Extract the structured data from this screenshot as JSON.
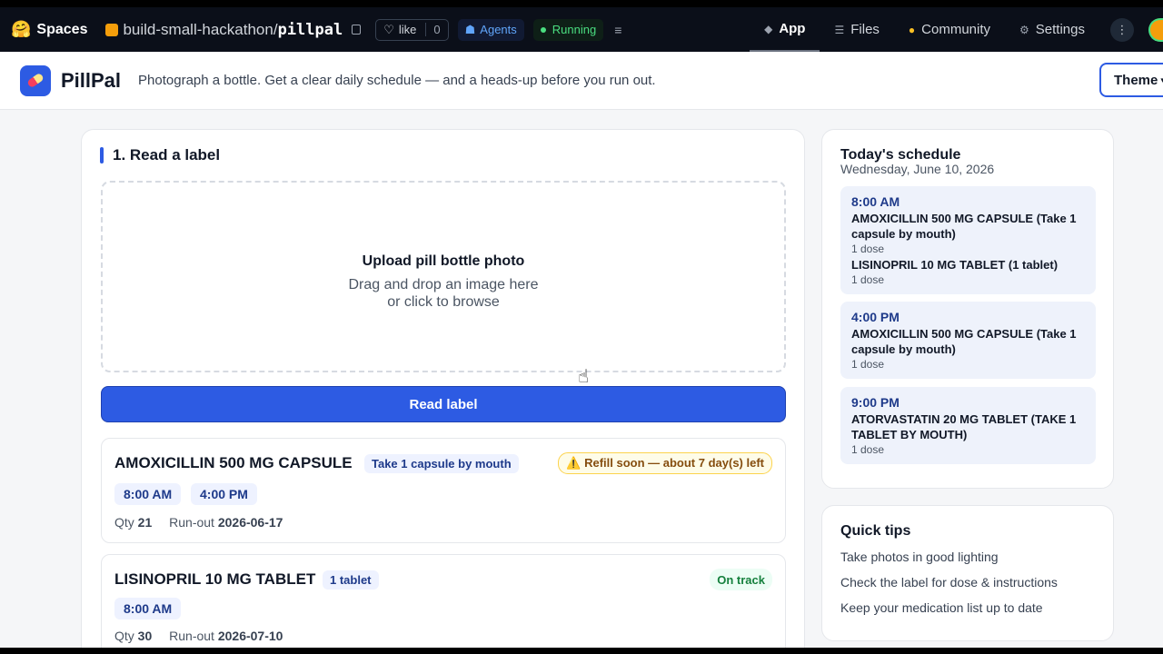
{
  "hf": {
    "logo_emoji": "🤗",
    "spaces_label": "Spaces",
    "owner": "build-small-hackathon",
    "separator": "/",
    "repo": "pillpal",
    "like_label": "like",
    "like_count": "0",
    "agents_label": "Agents",
    "status_label": "Running",
    "tabs": [
      {
        "label": "App",
        "icon": "cube-icon"
      },
      {
        "label": "Files",
        "icon": "files-icon"
      },
      {
        "label": "Community",
        "icon": "community-icon"
      },
      {
        "label": "Settings",
        "icon": "gear-icon"
      }
    ]
  },
  "app": {
    "brand": "PillPal",
    "tagline": "Photograph a bottle. Get a clear daily schedule — and a heads-up before you run out.",
    "theme_label": "Theme"
  },
  "read_section": {
    "title": "1. Read a label",
    "upload_title": "Upload pill bottle photo",
    "upload_line1": "Drag and drop an image here",
    "upload_line2": "or click to browse",
    "button_label": "Read label"
  },
  "medications": [
    {
      "name": "AMOXICILLIN 500 MG CAPSULE",
      "instruction": "Take 1 capsule by mouth",
      "status": "⚠️ Refill soon — about 7 day(s) left",
      "times": [
        "8:00 AM",
        "4:00 PM"
      ],
      "qty_label": "Qty",
      "qty": "21",
      "runout_label": "Run-out",
      "runout": "2026-06-17"
    },
    {
      "name": "LISINOPRIL 10 MG TABLET",
      "instruction": "1 tablet",
      "status": "On track",
      "times": [
        "8:00 AM"
      ],
      "qty_label": "Qty",
      "qty": "30",
      "runout_label": "Run-out",
      "runout": "2026-07-10"
    }
  ],
  "schedule": {
    "title": "Today's schedule",
    "date": "Wednesday, June 10, 2026",
    "slots": [
      {
        "time": "8:00 AM",
        "items": [
          {
            "drug": "AMOXICILLIN 500 MG CAPSULE (Take 1 capsule by mouth)",
            "dose": "1 dose"
          },
          {
            "drug": "LISINOPRIL 10 MG TABLET (1 tablet)",
            "dose": "1 dose"
          }
        ]
      },
      {
        "time": "4:00 PM",
        "items": [
          {
            "drug": "AMOXICILLIN 500 MG CAPSULE (Take 1 capsule by mouth)",
            "dose": "1 dose"
          }
        ]
      },
      {
        "time": "9:00 PM",
        "items": [
          {
            "drug": "ATORVASTATIN 20 MG TABLET (TAKE 1 TABLET BY MOUTH)",
            "dose": "1 dose"
          }
        ]
      }
    ]
  },
  "tips": {
    "title": "Quick tips",
    "items": [
      "Take photos in good lighting",
      "Check the label for dose & instructions",
      "Keep your medication list up to date"
    ]
  }
}
